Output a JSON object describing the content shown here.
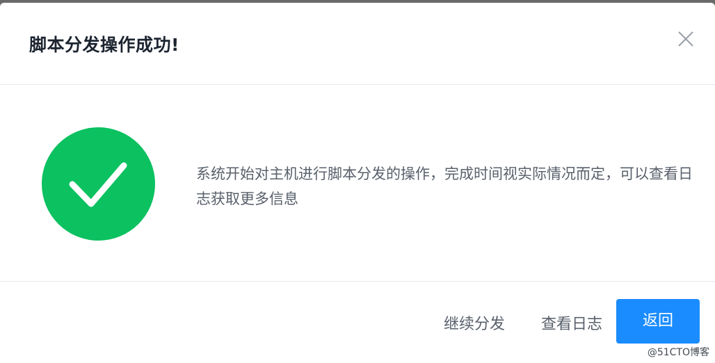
{
  "dialog": {
    "title": "脚本分发操作成功!",
    "message": "系统开始对主机进行脚本分发的操作，完成时间视实际情况而定，可以查看日志获取更多信息",
    "icon": "success-check-icon",
    "colors": {
      "success": "#0bc160",
      "primary": "#1a8cff"
    }
  },
  "footer": {
    "continue_label": "继续分发",
    "view_log_label": "查看日志",
    "return_label": "返回"
  },
  "watermark": "@51CTO博客"
}
